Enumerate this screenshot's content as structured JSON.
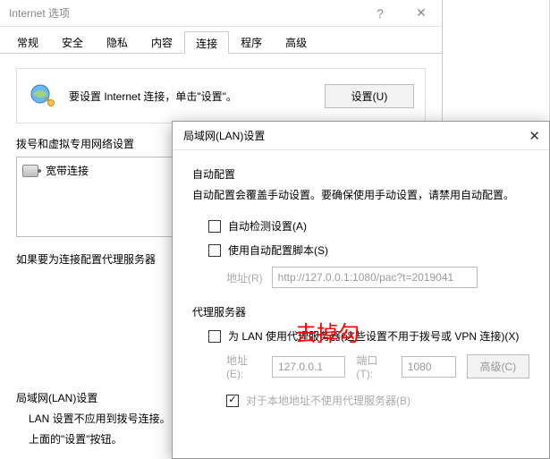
{
  "internet_options": {
    "title": "Internet 选项",
    "help_icon": "help-icon",
    "close_icon": "close-icon",
    "tabs": [
      "常规",
      "安全",
      "隐私",
      "内容",
      "连接",
      "程序",
      "高级"
    ],
    "active_tab_index": 4,
    "setup_text": "要设置 Internet 连接，单击\"设置\"。",
    "setup_button": "设置(U)",
    "dialup_label": "拨号和虚拟专用网络设置",
    "dialup_item": "宽带连接",
    "proxy_note": "如果要为连接配置代理服务器",
    "lan_label": "局域网(LAN)设置",
    "lan_desc1": "LAN 设置不应用到拨号连接。",
    "lan_desc2": "上面的\"设置\"按钮。"
  },
  "lan_settings": {
    "title": "局域网(LAN)设置",
    "auto_cfg_label": "自动配置",
    "auto_cfg_desc": "自动配置会覆盖手动设置。要确保使用手动设置，请禁用自动配置。",
    "auto_detect_label": "自动检测设置(A)",
    "auto_detect_checked": false,
    "use_script_label": "使用自动配置脚本(S)",
    "use_script_checked": false,
    "script_addr_label": "地址(R)",
    "script_addr_value": "http://127.0.0.1:1080/pac?t=2019041",
    "proxy_label": "代理服务器",
    "proxy_checkbox_label": "为 LAN 使用代理服务器(这些设置不用于拨号或 VPN 连接)(X)",
    "proxy_checked": false,
    "proxy_addr_label": "地址(E):",
    "proxy_addr_value": "127.0.0.1",
    "proxy_port_label": "端口(T):",
    "proxy_port_value": "1080",
    "advanced_button": "高级(C)",
    "bypass_label": "对于本地地址不使用代理服务器(B)",
    "bypass_checked": true
  },
  "annotation": {
    "text": "去掉勾",
    "color": "#ff0000"
  }
}
